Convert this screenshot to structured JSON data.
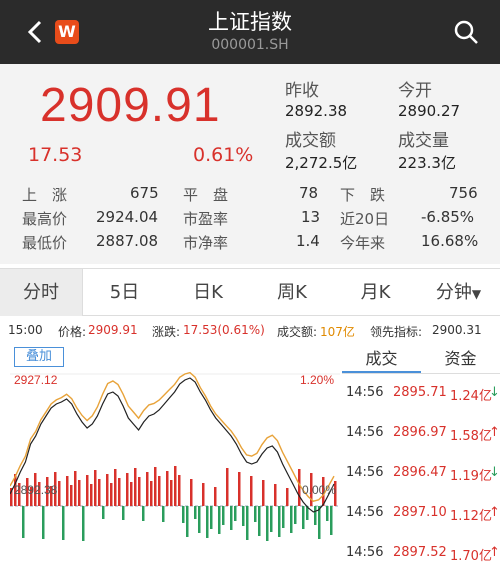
{
  "header": {
    "title": "上证指数",
    "code": "000001.SH",
    "badge": "W"
  },
  "quote": {
    "price": "2909.91",
    "change": "17.53",
    "change_pct": "0.61%",
    "prev_close_label": "昨收",
    "prev_close": "2892.38",
    "open_label": "今开",
    "open": "2890.27",
    "turnover_label": "成交额",
    "turnover": "2,272.5亿",
    "volume_label": "成交量",
    "volume": "223.3亿"
  },
  "stats": {
    "up_label": "上　涨",
    "up": "675",
    "flat_label": "平　盘",
    "flat": "78",
    "down_label": "下　跌",
    "down": "756",
    "high_label": "最高价",
    "high": "2924.04",
    "pe_label": "市盈率",
    "pe": "13",
    "d20_label": "近20日",
    "d20": "-6.85%",
    "low_label": "最低价",
    "low": "2887.08",
    "pb_label": "市净率",
    "pb": "1.4",
    "ytd_label": "今年来",
    "ytd": "16.68%"
  },
  "tabs": [
    "分时",
    "5日",
    "日K",
    "周K",
    "月K",
    "分钟"
  ],
  "info": {
    "time": "15:00",
    "price_label": "价格:",
    "price": "2909.91",
    "chg_label": "涨跌:",
    "chg": "17.53(0.61%)",
    "amt_label": "成交额:",
    "amt": "107亿",
    "lead_label": "领先指标:",
    "lead": "2900.31"
  },
  "chart": {
    "overlay_label": "叠加",
    "top_price": "2927.12",
    "top_pct": "1.20%",
    "mid_price": "2892.38",
    "mid_pct": "0.00%",
    "colors": {
      "up": "#d8312b",
      "down": "#2a9d5c",
      "line": "#222222",
      "avg": "#e8a33a"
    }
  },
  "trades": {
    "tab_trades": "成交",
    "tab_funds": "资金",
    "rows": [
      {
        "time": "14:56",
        "price": "2895.71",
        "amt": "1.24亿",
        "dir": "↓"
      },
      {
        "time": "14:56",
        "price": "2896.97",
        "amt": "1.58亿",
        "dir": "↑"
      },
      {
        "time": "14:56",
        "price": "2896.47",
        "amt": "1.19亿",
        "dir": "↓"
      },
      {
        "time": "14:56",
        "price": "2897.10",
        "amt": "1.12亿",
        "dir": "↑"
      },
      {
        "time": "14:56",
        "price": "2897.52",
        "amt": "1.70亿",
        "dir": "↑"
      }
    ]
  }
}
